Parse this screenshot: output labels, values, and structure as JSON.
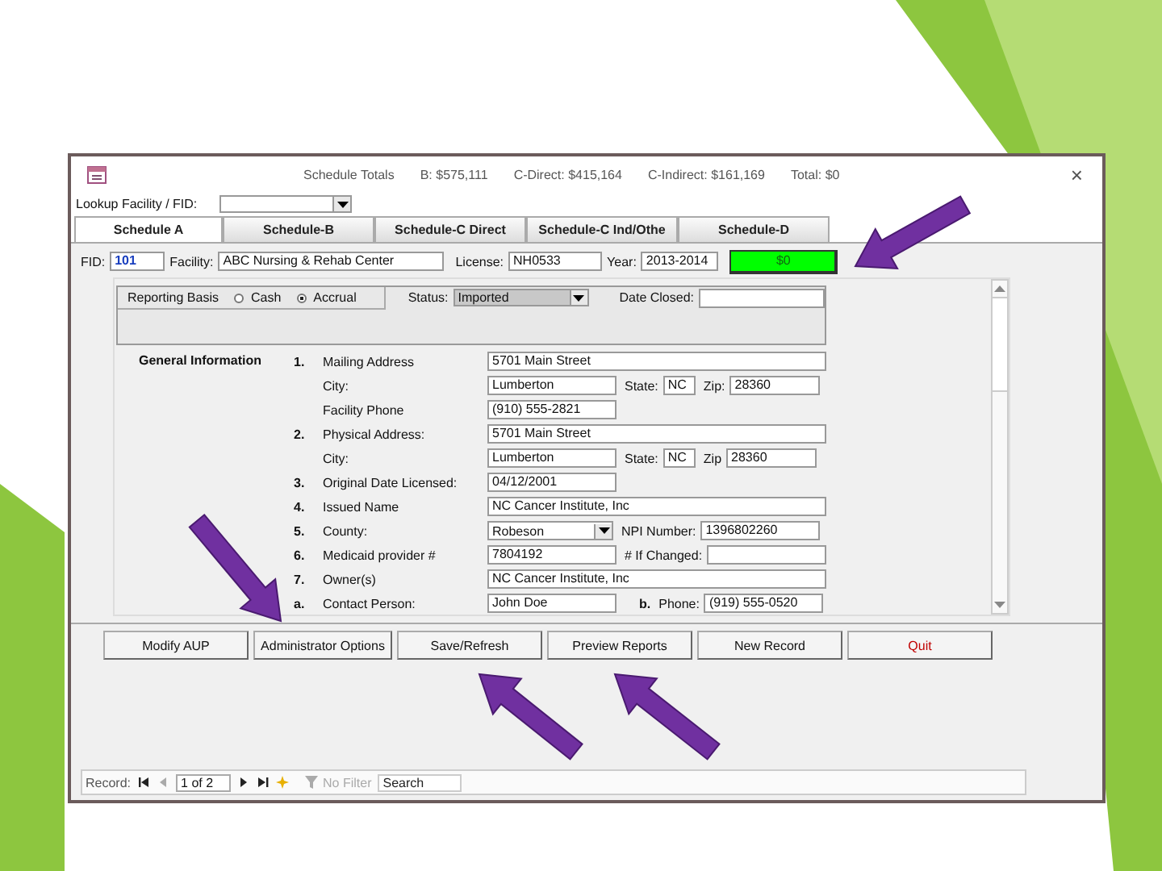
{
  "window": {
    "summary": [
      {
        "label": "Schedule Totals"
      },
      {
        "label": "B: $575,111"
      },
      {
        "label": "C-Direct: $415,164"
      },
      {
        "label": "C-Indirect: $161,169"
      },
      {
        "label": "Total: $0"
      }
    ],
    "close": "×"
  },
  "lookup": {
    "label": "Lookup Facility / FID:"
  },
  "tabs": [
    {
      "label": "Schedule A",
      "selected": true
    },
    {
      "label": "Schedule-B",
      "selected": false
    },
    {
      "label": "Schedule-C Direct",
      "selected": false
    },
    {
      "label": "Schedule-C Ind/Othe",
      "selected": false
    },
    {
      "label": "Schedule-D",
      "selected": false
    }
  ],
  "header": {
    "fid_label": "FID:",
    "fid": "101",
    "facility_label": "Facility:",
    "facility": "ABC Nursing & Rehab Center",
    "license_label": "License:",
    "license": "NH0533",
    "year_label": "Year:",
    "year": "2013-2014",
    "balance": "$0"
  },
  "reporting": {
    "label": "Reporting Basis",
    "options": [
      {
        "label": "Cash",
        "selected": false
      },
      {
        "label": "Accrual",
        "selected": true
      }
    ],
    "status_label": "Status:",
    "status": "Imported",
    "date_closed_label": "Date Closed:"
  },
  "section": "General Information",
  "rows": [
    {
      "number": "1.",
      "label": "Mailing Address",
      "fields": [
        {
          "kind": "long",
          "value": "5701 Main Street"
        }
      ]
    },
    {
      "label": "City:",
      "fields": [
        {
          "kind": "short",
          "value": "Lumberton"
        },
        {
          "kind": "tiny",
          "caption": "State:",
          "value": "NC"
        },
        {
          "kind": "zip",
          "caption": "Zip:",
          "value": "28360"
        }
      ]
    },
    {
      "label": "Facility Phone",
      "fields": [
        {
          "kind": "short",
          "value": "(910) 555-2821"
        }
      ]
    },
    {
      "number": "2.",
      "label": "Physical Address:",
      "fields": [
        {
          "kind": "long",
          "value": "5701 Main Street"
        }
      ]
    },
    {
      "label": "City:",
      "fields": [
        {
          "kind": "short",
          "value": "Lumberton"
        },
        {
          "kind": "tiny",
          "caption": "State:",
          "value": "NC"
        },
        {
          "kind": "zip",
          "caption": "Zip",
          "value": "28360"
        }
      ]
    },
    {
      "number": "3.",
      "label": "Original Date Licensed:",
      "fields": [
        {
          "kind": "short",
          "value": "04/12/2001"
        }
      ]
    },
    {
      "number": "4.",
      "label": "Issued Name",
      "fields": [
        {
          "kind": "long",
          "value": "NC Cancer Institute, Inc"
        }
      ]
    },
    {
      "number": "5.",
      "label": "County:",
      "fields": [
        {
          "kind": "combo",
          "value": "Robeson"
        },
        {
          "kind": "mid",
          "caption": "NPI Number:",
          "value": "1396802260"
        }
      ]
    },
    {
      "number": "6.",
      "label": "Medicaid provider #",
      "fields": [
        {
          "kind": "short",
          "value": "7804192"
        },
        {
          "kind": "mid",
          "caption": "# If Changed:"
        }
      ]
    },
    {
      "number": "7.",
      "label": "Owner(s)",
      "fields": [
        {
          "kind": "long",
          "value": "NC Cancer Institute, Inc"
        }
      ]
    },
    {
      "number": "a.",
      "label": "Contact Person:",
      "fields": [
        {
          "kind": "short",
          "value": "John Doe"
        },
        {
          "kind": "mid",
          "marker": "b.",
          "caption": "Phone:",
          "value": "(919) 555-0520"
        }
      ]
    }
  ],
  "buttons": [
    {
      "label": "Modify AUP",
      "kind": "normal"
    },
    {
      "label": "Administrator Options",
      "kind": "normal"
    },
    {
      "label": "Save/Refresh",
      "kind": "normal"
    },
    {
      "label": "Preview Reports",
      "kind": "normal"
    },
    {
      "label": "New Record",
      "kind": "normal"
    },
    {
      "label": "Quit",
      "kind": "danger"
    }
  ],
  "navigation": {
    "label": "Record:",
    "position": "1 of 2",
    "filter": "No Filter",
    "filter_disabled": true,
    "search_placeholder": "Search"
  }
}
